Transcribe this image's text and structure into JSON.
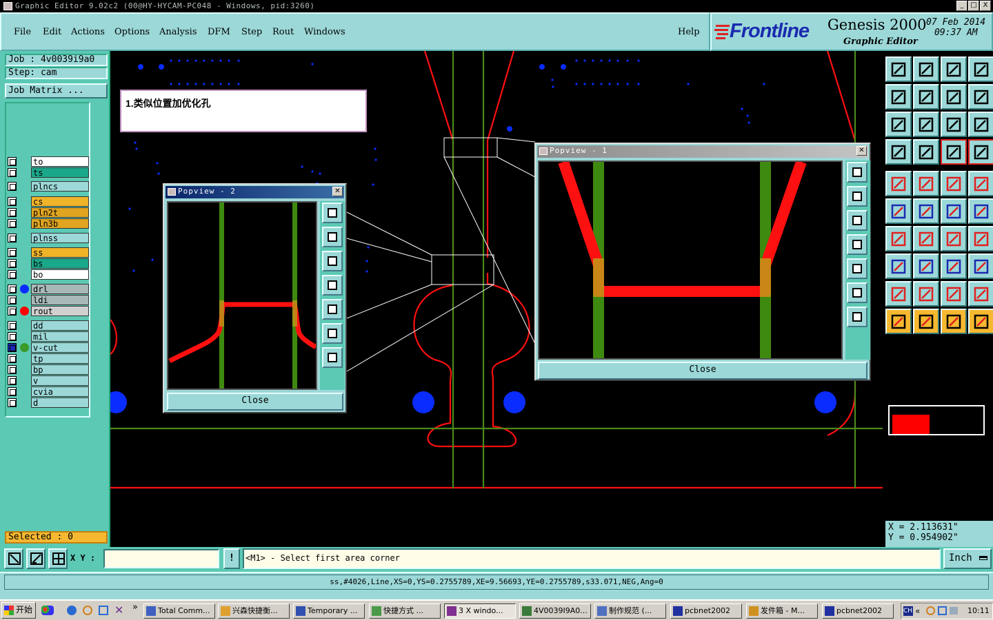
{
  "titlebar": {
    "title": "Graphic Editor 9.02c2 (00@HY-HYCAM-PC048 - Windows, pid:3260)",
    "minimize": "_",
    "maximize": "□",
    "close": "X"
  },
  "menu": {
    "items": [
      "File",
      "Edit",
      "Actions",
      "Options",
      "Analysis",
      "DFM",
      "Step",
      "Rout",
      "Windows"
    ],
    "help": "Help"
  },
  "brand": {
    "logo": "Frontline",
    "product": "Genesis 2000",
    "subtitle": "Graphic Editor",
    "date": "07 Feb 2014",
    "time": "09:37 AM"
  },
  "job": {
    "job_label": "Job : 4v0039i9a0",
    "step_label": "Step: cam",
    "matrix_button": "Job Matrix ...",
    "selected": "Selected : 0"
  },
  "layers": [
    {
      "name": "to",
      "color": "#ffffff"
    },
    {
      "name": "ts",
      "color": "#1aa88a"
    },
    {
      "name": "plncs",
      "color": "#9cd8d8"
    },
    {
      "name": "cs",
      "color": "#f0b429",
      "mark": true
    },
    {
      "name": "pln2t",
      "color": "#e0a420"
    },
    {
      "name": "pln3b",
      "color": "#e0a420"
    },
    {
      "name": "plnss",
      "color": "#9cd8d8"
    },
    {
      "name": "ss",
      "color": "#f0b429",
      "mark": true
    },
    {
      "name": "bs",
      "color": "#1aa88a"
    },
    {
      "name": "bo",
      "color": "#ffffff"
    },
    {
      "name": "drl",
      "color": "#a8b8b8",
      "dot": "#0a2cff"
    },
    {
      "name": "ldi",
      "color": "#a8b8b8"
    },
    {
      "name": "rout",
      "color": "#d0d0d0",
      "dot": "#ff0000"
    },
    {
      "name": "dd",
      "color": "#9cd8d8"
    },
    {
      "name": "mil",
      "color": "#9cd8d8"
    },
    {
      "name": "v-cut",
      "color": "#9cd8d8",
      "dot": "#3a9a2a",
      "mark": true,
      "filled_cb": true
    },
    {
      "name": "tp",
      "color": "#9cd8d8"
    },
    {
      "name": "bp",
      "color": "#9cd8d8"
    },
    {
      "name": "v",
      "color": "#9cd8d8"
    },
    {
      "name": "cvia",
      "color": "#9cd8d8"
    },
    {
      "name": "d",
      "color": "#9cd8d8"
    }
  ],
  "note": "1.类似位置加优化孔",
  "popview2": {
    "title": "Popview - 2",
    "close_button": "Close"
  },
  "popview1": {
    "title": "Popview - 1",
    "close_button": "Close"
  },
  "coords": {
    "x": "X = 2.113631\"",
    "y": "Y = 0.954902\""
  },
  "input": {
    "xy_label": "X Y :",
    "value": "",
    "prompt": "<M1> - Select first area corner",
    "units": "Inch",
    "info_button": "!"
  },
  "status": "ss,#4026,Line,XS=0,YS=0.2755789,XE=9.56693,YE=0.2755789,s33.071,NEG,Ang=0",
  "taskbar": {
    "start": "开始",
    "items": [
      "Total Comm...",
      "兴森快捷衡...",
      "Temporary ...",
      "快捷方式 ...",
      "3 X windo...",
      "4V0039I9A0...",
      "制作规范 (...",
      "pcbnet2002",
      "发件箱 - M...",
      "pcbnet2002"
    ],
    "tray_label": "CH",
    "clock": "10:11"
  },
  "colors": {
    "panel": "#9cd8d8",
    "panel_dark": "#5cc9b4",
    "trace_red": "#ff0000",
    "vcut_green": "#4a8a1a",
    "drill_blue": "#0a2cff"
  }
}
